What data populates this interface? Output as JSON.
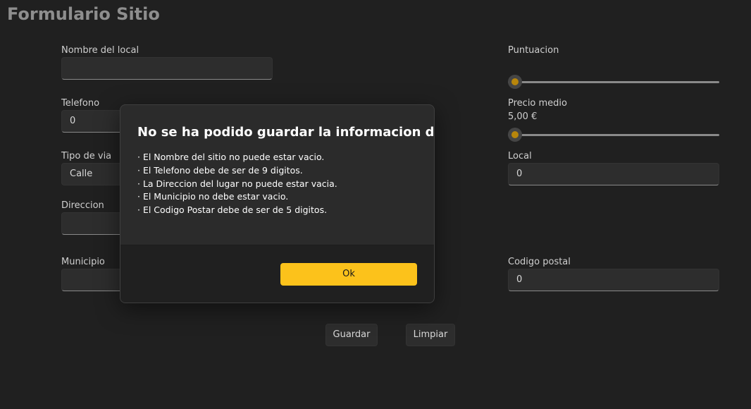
{
  "page": {
    "title": "Formulario Sitio"
  },
  "form": {
    "nombre": {
      "label": "Nombre del local",
      "value": ""
    },
    "telefono": {
      "label": "Telefono",
      "value": "0"
    },
    "tipo_via": {
      "label": "Tipo de via",
      "value": "Calle"
    },
    "direccion": {
      "label": "Direccion",
      "value": ""
    },
    "municipio": {
      "label": "Municipio",
      "value": ""
    },
    "puntuacion": {
      "label": "Puntuacion",
      "value": 0
    },
    "precio_medio": {
      "label": "Precio medio",
      "display": "5,00 €",
      "value": 0
    },
    "local": {
      "label": "Local",
      "value": "0"
    },
    "codigo_postal": {
      "label": "Codigo postal",
      "value": "0"
    }
  },
  "actions": {
    "save_label": "Guardar",
    "clear_label": "Limpiar"
  },
  "dialog": {
    "title": "No se ha podido guardar la informacion de:",
    "errors": [
      "· El Nombre del sitio no puede estar vacio.",
      "· El Telefono debe de ser de 9 digitos.",
      "· La Direccion del lugar no puede estar vacia.",
      "· El Municipio no debe estar vacio.",
      "· El Codigo Postar debe de ser de 5 digitos."
    ],
    "ok_label": "Ok"
  },
  "colors": {
    "accent": "#fcc21b",
    "slider_thumb": "#b8860b",
    "background": "#202020"
  }
}
